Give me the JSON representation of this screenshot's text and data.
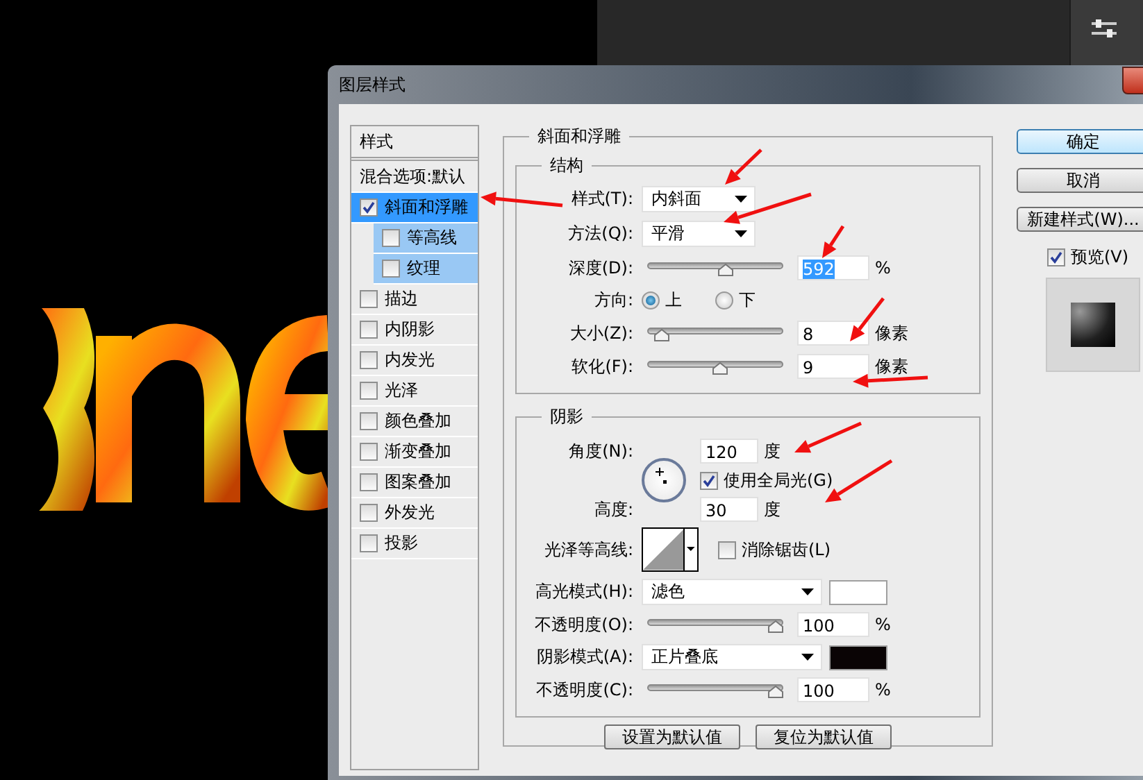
{
  "dialog": {
    "title": "图层样式"
  },
  "style_list": {
    "header": "样式",
    "blend_options": "混合选项:默认",
    "items": [
      {
        "label": "斜面和浮雕",
        "checked": true,
        "selected": true,
        "children": [
          {
            "label": "等高线",
            "checked": false,
            "selected": false
          },
          {
            "label": "纹理",
            "checked": false,
            "selected": false
          }
        ]
      },
      {
        "label": "描边",
        "checked": false,
        "selected": false
      },
      {
        "label": "内阴影",
        "checked": false,
        "selected": false
      },
      {
        "label": "内发光",
        "checked": false,
        "selected": false
      },
      {
        "label": "光泽",
        "checked": false,
        "selected": false
      },
      {
        "label": "颜色叠加",
        "checked": false,
        "selected": false
      },
      {
        "label": "渐变叠加",
        "checked": false,
        "selected": false
      },
      {
        "label": "图案叠加",
        "checked": false,
        "selected": false
      },
      {
        "label": "外发光",
        "checked": false,
        "selected": false
      },
      {
        "label": "投影",
        "checked": false,
        "selected": false
      }
    ]
  },
  "bevel_emboss": {
    "title": "斜面和浮雕",
    "structure": {
      "title": "结构",
      "style": {
        "label": "样式(T):",
        "value": "内斜面"
      },
      "technique": {
        "label": "方法(Q):",
        "value": "平滑"
      },
      "depth": {
        "label": "深度(D):",
        "level": 0.59,
        "value": "592",
        "highlighted": true,
        "unit": "%"
      },
      "direction": {
        "label": "方向:",
        "options": [
          {
            "label": "上",
            "selected": true
          },
          {
            "label": "下",
            "selected": false
          }
        ]
      },
      "size": {
        "label": "大小(Z):",
        "level": 0.06,
        "value": "8",
        "highlighted": false,
        "unit": "像素"
      },
      "soften": {
        "label": "软化(F):",
        "level": 0.54,
        "value": "9",
        "highlighted": false,
        "unit": "像素"
      }
    },
    "shading": {
      "title": "阴影",
      "angle": {
        "label": "角度(N):",
        "value": "120",
        "unit": "度"
      },
      "global_light": {
        "label": "使用全局光(G)",
        "checked": true
      },
      "altitude": {
        "label": "高度:",
        "value": "30",
        "unit": "度"
      },
      "gloss_contour": {
        "label": "光泽等高线:"
      },
      "anti_aliased": {
        "label": "消除锯齿(L)",
        "checked": false
      },
      "highlight_mode": {
        "label": "高光模式(H):",
        "value": "滤色",
        "color": "#ffffff"
      },
      "highlight_opacity": {
        "label": "不透明度(O):",
        "level": 1,
        "value": "100",
        "unit": "%"
      },
      "shadow_mode": {
        "label": "阴影模式(A):",
        "value": "正片叠底",
        "color": "#0a0405"
      },
      "shadow_opacity": {
        "label": "不透明度(C):",
        "level": 1,
        "value": "100",
        "unit": "%"
      }
    },
    "buttons": [
      "设置为默认值",
      "复位为默认值"
    ]
  },
  "actions": {
    "buttons": [
      {
        "label": "确定",
        "default": true
      },
      {
        "label": "取消",
        "default": false
      },
      {
        "label": "新建样式(W)...",
        "default": false
      }
    ],
    "preview": {
      "label": "预览(V)",
      "checked": true
    }
  }
}
